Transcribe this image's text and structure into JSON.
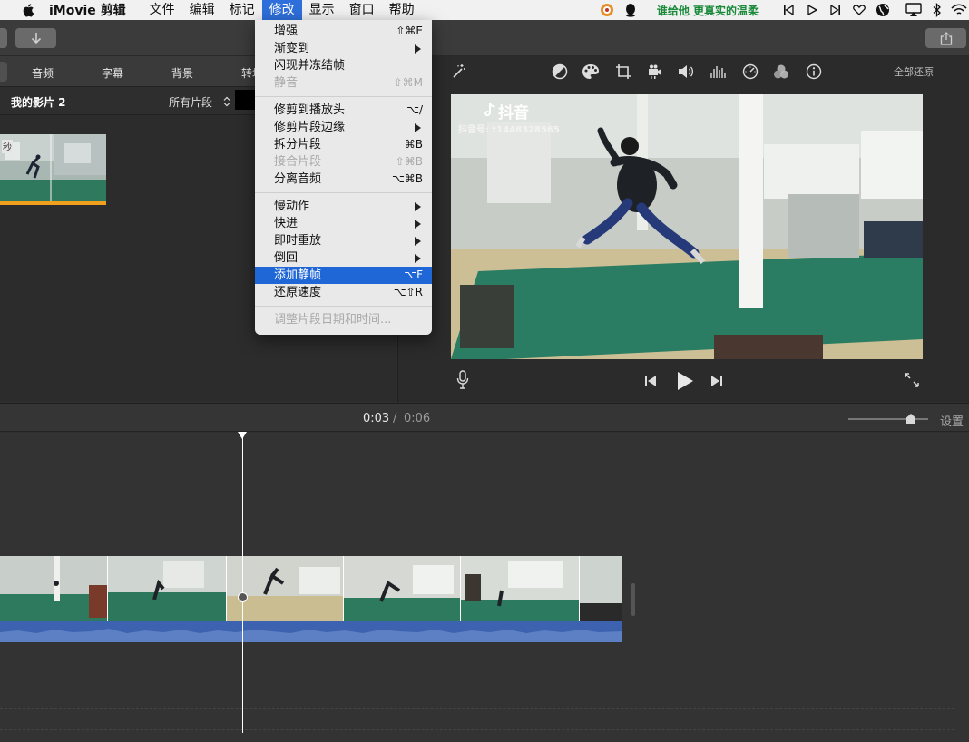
{
  "menubar": {
    "app_name": "iMovie 剪辑",
    "items": [
      "文件",
      "编辑",
      "标记",
      "修改",
      "显示",
      "窗口",
      "帮助"
    ],
    "active": "修改",
    "now_playing": "谁给他 更真实的温柔"
  },
  "browser": {
    "tabs": [
      "音频",
      "字幕",
      "背景",
      "转场"
    ],
    "project_title": "我的影片 2",
    "filter": "所有片段",
    "clip_badge": "秒"
  },
  "viewer": {
    "reset_all": "全部还原",
    "watermark_brand": "抖音",
    "watermark_id": "抖音号: t1448328565"
  },
  "timeline": {
    "current_time": "0:03",
    "separator": "/",
    "total_time": "0:06",
    "settings_label": "设置"
  },
  "modify_menu": {
    "group1": [
      {
        "label": "增强",
        "shortcut": "⇧⌘E",
        "disabled": false,
        "submenu": false
      },
      {
        "label": "渐变到",
        "shortcut": "",
        "disabled": false,
        "submenu": true
      },
      {
        "label": "闪现并冻结帧",
        "shortcut": "",
        "disabled": false,
        "submenu": false
      },
      {
        "label": "静音",
        "shortcut": "⇧⌘M",
        "disabled": true,
        "submenu": false
      }
    ],
    "group2": [
      {
        "label": "修剪到播放头",
        "shortcut": "⌥/",
        "disabled": false,
        "submenu": false
      },
      {
        "label": "修剪片段边缘",
        "shortcut": "",
        "disabled": false,
        "submenu": true
      },
      {
        "label": "拆分片段",
        "shortcut": "⌘B",
        "disabled": false,
        "submenu": false
      },
      {
        "label": "接合片段",
        "shortcut": "⇧⌘B",
        "disabled": true,
        "submenu": false
      },
      {
        "label": "分离音频",
        "shortcut": "⌥⌘B",
        "disabled": false,
        "submenu": false
      }
    ],
    "group3": [
      {
        "label": "慢动作",
        "shortcut": "",
        "disabled": false,
        "submenu": true
      },
      {
        "label": "快进",
        "shortcut": "",
        "disabled": false,
        "submenu": true
      },
      {
        "label": "即时重放",
        "shortcut": "",
        "disabled": false,
        "submenu": true
      },
      {
        "label": "倒回",
        "shortcut": "",
        "disabled": false,
        "submenu": true
      },
      {
        "label": "添加静帧",
        "shortcut": "⌥F",
        "disabled": false,
        "submenu": false,
        "highlighted": true
      },
      {
        "label": "还原速度",
        "shortcut": "⌥⇧R",
        "disabled": false,
        "submenu": false
      }
    ],
    "group4": [
      {
        "label": "调整片段日期和时间...",
        "shortcut": "",
        "disabled": true,
        "submenu": false
      }
    ]
  },
  "colors": {
    "menu_highlight": "#1f66d6",
    "audio_track": "#3c62b0",
    "clip_selection": "#f0a01e",
    "now_playing_green": "#1a8a3a"
  }
}
